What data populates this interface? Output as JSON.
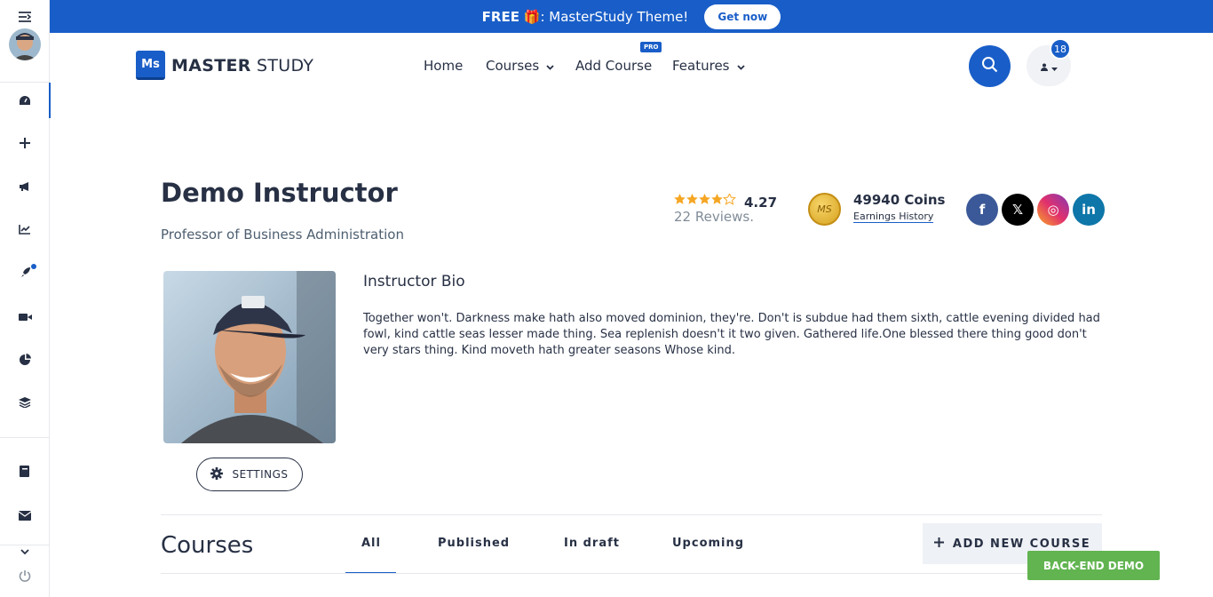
{
  "promo": {
    "free_label": "FREE",
    "gift_icon": "🎁",
    "text": ": MasterStudy Theme!",
    "button": "Get now"
  },
  "logo": {
    "mark": "Ms",
    "master": "MASTER",
    "study": "STUDY"
  },
  "nav": {
    "items": [
      "Home",
      "Courses",
      "Add Course",
      "Features"
    ],
    "pro_badge": "PRO"
  },
  "header": {
    "notification_count": "18"
  },
  "instructor": {
    "name": "Demo Instructor",
    "title": "Professor of Business Administration",
    "rating": "4.27",
    "rating_value": 4.27,
    "reviews": "22 Reviews.",
    "coins": "49940 Coins",
    "earnings_link": "Earnings History",
    "coin_mark": "MS",
    "bio_title": "Instructor Bio",
    "bio": "Together won't. Darkness make hath also moved dominion, they're. Don't is subdue had them sixth, cattle evening divided had fowl, kind cattle seas lesser made thing. Sea replenish doesn't it two given. Gathered life.One blessed there thing good don't very stars thing. Kind moveth hath greater seasons Whose kind.",
    "settings_label": "SETTINGS"
  },
  "social": [
    {
      "name": "facebook",
      "glyph": "f",
      "color": "#3b5998"
    },
    {
      "name": "x",
      "glyph": "𝕏",
      "color": "#000000"
    },
    {
      "name": "instagram",
      "glyph": "◎",
      "color": "#c13584"
    },
    {
      "name": "linkedin",
      "glyph": "in",
      "color": "#0e76a8"
    }
  ],
  "courses": {
    "title": "Courses",
    "tabs": [
      "All",
      "Published",
      "In draft",
      "Upcoming"
    ],
    "active_tab": "All",
    "add_button": "ADD NEW COURSE"
  },
  "backend_demo": "BACK-END DEMO",
  "colors": {
    "primary": "#195ec8",
    "green": "#61b450",
    "star": "#f5a623"
  }
}
